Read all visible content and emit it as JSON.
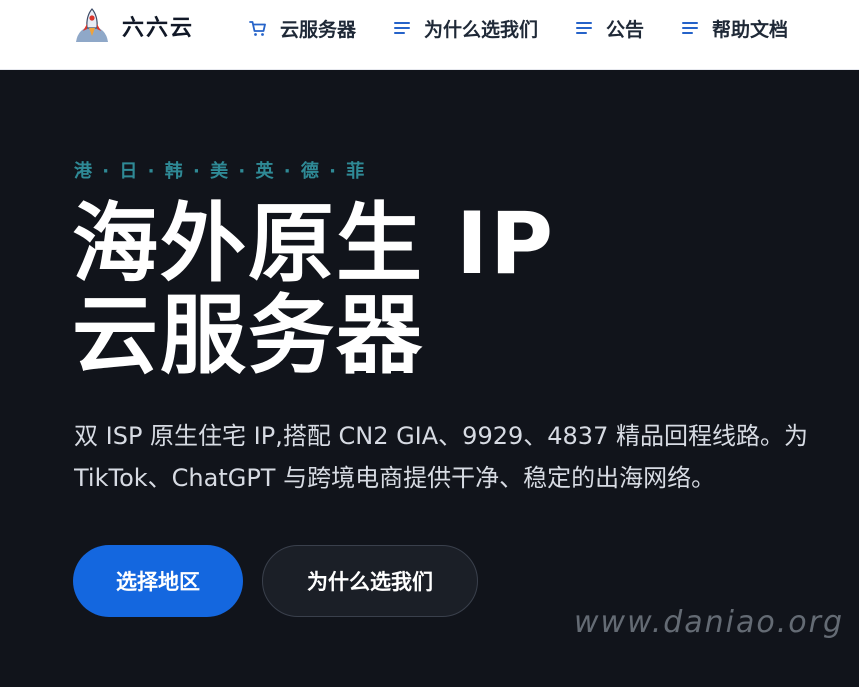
{
  "brand": {
    "name": "六六云",
    "logo_icon": "rocket-icon"
  },
  "nav": {
    "items": [
      {
        "label": "云服务器",
        "icon": "cart-icon"
      },
      {
        "label": "为什么选我们",
        "icon": "menu-lines-icon"
      },
      {
        "label": "公告",
        "icon": "menu-lines-icon"
      },
      {
        "label": "帮助文档",
        "icon": "menu-lines-icon"
      }
    ]
  },
  "hero": {
    "regions": "港 · 日 · 韩 · 美 · 英 · 德 · 菲",
    "headline_line1": "海外原生 IP",
    "headline_line2": "云服务器",
    "desc_line1": "双 ISP 原生住宅 IP,搭配 CN2 GIA、9929、4837 精品回程线路。为",
    "desc_line2": "TikTok、ChatGPT 与跨境电商提供干净、稳定的出海网络。",
    "primary_cta": "选择地区",
    "secondary_cta": "为什么选我们"
  },
  "watermark": "www.daniao.org",
  "colors": {
    "accent_blue": "#1467df",
    "region_teal": "#2f8a96",
    "nav_icon_blue": "#2563c9",
    "hero_bg": "#11141b"
  }
}
